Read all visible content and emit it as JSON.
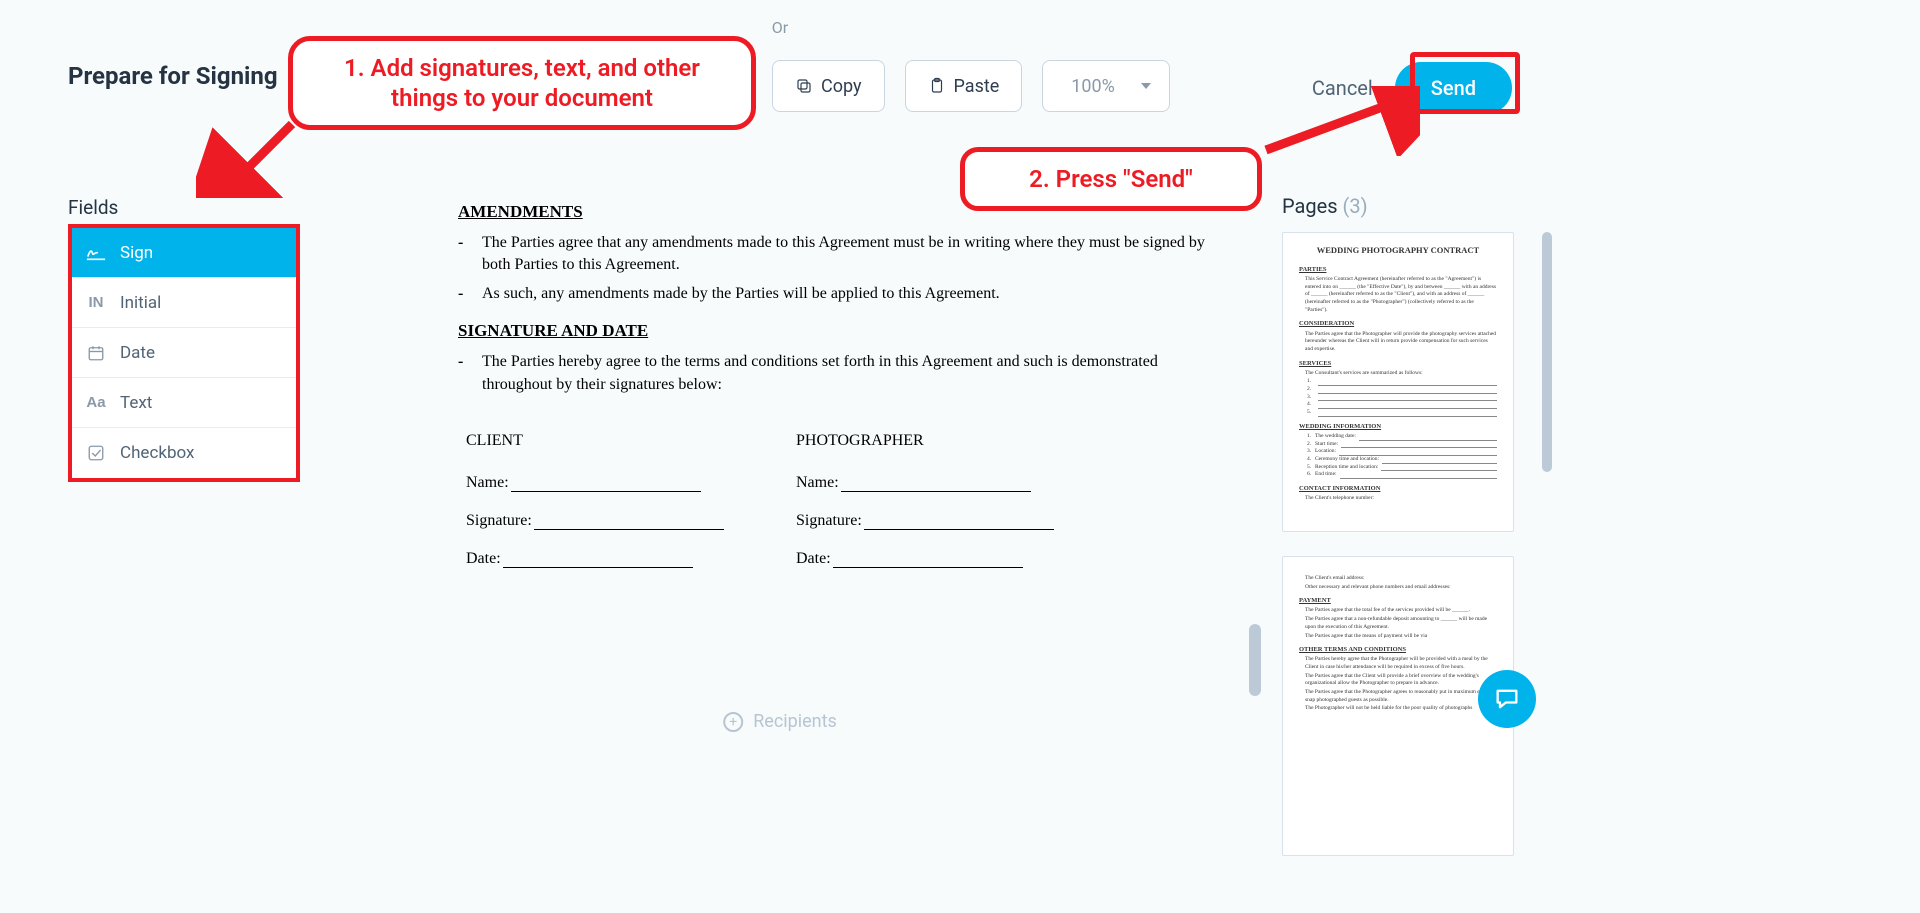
{
  "or_label": "Or",
  "page_title": "Prepare for Signing",
  "annotations": {
    "step1": "1. Add signatures, text, and other things to your document",
    "step2": "2. Press \"Send\""
  },
  "toolbar": {
    "copy": "Copy",
    "paste": "Paste",
    "zoom": "100%"
  },
  "header": {
    "cancel": "Cancel",
    "send": "Send"
  },
  "fields": {
    "heading": "Fields",
    "items": [
      {
        "label": "Sign",
        "icon": "sign-icon",
        "active": true
      },
      {
        "label": "Initial",
        "icon": "initial-icon",
        "active": false
      },
      {
        "label": "Date",
        "icon": "date-icon",
        "active": false
      },
      {
        "label": "Text",
        "icon": "text-icon",
        "active": false
      },
      {
        "label": "Checkbox",
        "icon": "checkbox-icon",
        "active": false
      }
    ]
  },
  "document": {
    "amendments_heading": "AMENDMENTS",
    "amendments_b1": "The Parties agree that any amendments made to this Agreement must be in writing where they must be signed by both Parties to this Agreement.",
    "amendments_b2": "As such, any amendments made by the Parties will be applied to this Agreement.",
    "sig_heading": "SIGNATURE AND DATE",
    "sig_b1": "The Parties hereby agree to the terms and conditions set forth in this Agreement and such is demonstrated throughout by their signatures below:",
    "client_title": "CLIENT",
    "photographer_title": "PHOTOGRAPHER",
    "name_label": "Name:",
    "signature_label": "Signature:",
    "date_label": "Date:"
  },
  "pages": {
    "heading": "Pages",
    "count": "(3)",
    "thumb1": {
      "title": "WEDDING PHOTOGRAPHY CONTRACT",
      "s1": "PARTIES",
      "p1": "This Service Contract Agreement (hereinafter referred to as the \"Agreement\") is entered into on ______ (the \"Effective Date\"), by and between ______ with an address of ______ (hereinafter referred to as the \"Client\"), and with an address of ______ (hereinafter referred to as the \"Photographer\") (collectively referred to as the \"Parties\").",
      "s2": "CONSIDERATION",
      "p2": "The Parties agree that the Photographer will provide the photography services attached hereunder whereas the Client will in return provide compensation for such services and expertise.",
      "s3": "SERVICES",
      "p3": "The Consultant's services are summarized as follows:",
      "s4": "WEDDING INFORMATION",
      "w1": "The wedding date:",
      "w2": "Start time:",
      "w3": "Location:",
      "w4": "Ceremony time and location:",
      "w5": "Reception time and location:",
      "w6": "End time:",
      "s5": "CONTACT INFORMATION",
      "c1": "The Client's telephone number:"
    },
    "thumb2": {
      "c1": "The Client's email address:",
      "c2": "Other necessary and relevant phone numbers and email addresses:",
      "s1": "PAYMENT",
      "p1": "The Parties agree that the total fee of the services provided will be ______.",
      "p2": "The Parties agree that a non-refundable deposit amounting to ______ will be made upon the execution of this Agreement.",
      "p3": "The Parties agree that the means of payment will be via",
      "s2": "OTHER TERMS AND CONDITIONS",
      "o1": "The Parties hereby agree that the Photographer will be provided with a meal by the Client in case his/her attendance will be required in excess of five hours.",
      "o2": "The Parties agree that the Client will provide a brief overview of the wedding's organizational allow the Photographer to prepare in advance.",
      "o3": "The Parties agree that the Photographer agrees to reasonably put in maximum effort to snap photographed guests as possible.",
      "o4": "The Photographer will not be held liable for the poor quality of photographs"
    }
  },
  "recipients_label": "Recipients"
}
